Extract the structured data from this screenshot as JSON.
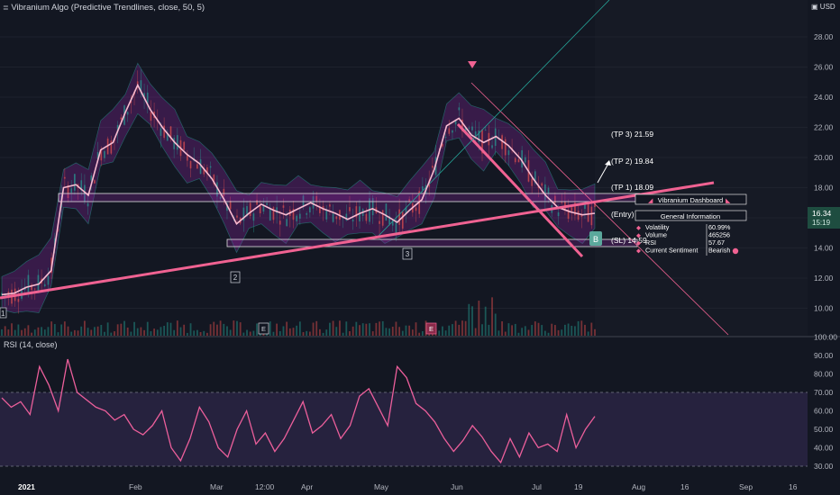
{
  "header": {
    "title": "Vibranium Algo (Predictive Trendlines, close, 50, 5)",
    "currency": "USD"
  },
  "price_axis": {
    "ticks": [
      "28.00",
      "26.00",
      "24.00",
      "22.00",
      "20.00",
      "18.00",
      "16.00",
      "14.00",
      "12.00",
      "10.00"
    ],
    "last_price": "16.34",
    "countdown": "15:19"
  },
  "rsi_axis": {
    "title": "RSI (14, close)",
    "ticks": [
      "100.00",
      "90.00",
      "80.00",
      "70.00",
      "60.00",
      "50.00",
      "40.00",
      "30.00"
    ]
  },
  "time_axis": {
    "labels": [
      "2021",
      "Feb",
      "Mar",
      "12:00",
      "Apr",
      "May",
      "Jun",
      "Jul",
      "19",
      "Aug",
      "16",
      "Sep",
      "16"
    ]
  },
  "levels": {
    "tp3": "(TP 3) 21.59",
    "tp2": "(TP 2) 19.84",
    "tp1": "(TP 1) 18.09",
    "entry": "(Entry) 16.34",
    "sl": "(SL) 14.59"
  },
  "markers": {
    "pivot_1": "1",
    "pivot_2": "2",
    "pivot_3": "3",
    "earnings_1": "E",
    "earnings_2": "E",
    "buy_signal": "B"
  },
  "dashboard": {
    "title": "Vibranium Dashboard",
    "section": "General Information",
    "rows": [
      {
        "label": "Volatility",
        "value": "60.99%"
      },
      {
        "label": "Volume",
        "value": "465256"
      },
      {
        "label": "RSI",
        "value": "57.67"
      },
      {
        "label": "Current Sentiment",
        "value": "Bearish"
      }
    ]
  },
  "colors": {
    "background": "#131722",
    "pink": "#f06292",
    "purple": "#9c27b0",
    "teal": "#26a69a",
    "rsi": "#ec5f9b",
    "last_price_bg": "#1e4d40"
  },
  "chart_data": {
    "type": "line",
    "title": "Vibranium Algo (Predictive Trendlines, close, 50, 5)",
    "x_months": [
      "2021",
      "Feb",
      "Mar",
      "Apr",
      "May",
      "Jun",
      "Jul",
      "Aug",
      "Sep"
    ],
    "ylim": [
      9,
      29
    ],
    "series": [
      {
        "values": [
          10.9,
          11.0,
          11.4,
          11.6,
          12.5,
          18.0,
          18.2,
          17.5,
          20.5,
          21.0,
          23.0,
          24.8,
          23.2,
          22.0,
          21.0,
          20.2,
          19.6,
          18.6,
          17.2,
          15.6,
          16.3,
          16.9,
          16.5,
          16.2,
          16.6,
          17.0,
          16.6,
          16.3,
          15.9,
          16.3,
          16.6,
          16.2,
          15.7,
          16.5,
          17.2,
          19.2,
          22.1,
          22.6,
          21.5,
          21.0,
          21.4,
          20.8,
          19.9,
          18.6,
          17.5,
          16.7,
          16.4,
          16.2,
          16.3
        ]
      }
    ],
    "trendlines": [
      {
        "x": [
          "2021",
          "Aug"
        ],
        "y": [
          10.9,
          18.4
        ]
      }
    ],
    "rsi": {
      "name": "RSI (14, close)",
      "ylim": [
        27,
        100
      ],
      "levels": [
        70,
        30
      ],
      "values": [
        67,
        62,
        65,
        58,
        84,
        74,
        60,
        88,
        70,
        66,
        62,
        60,
        55,
        58,
        50,
        47,
        52,
        60,
        40,
        33,
        45,
        62,
        54,
        40,
        35,
        50,
        60,
        42,
        48,
        38,
        45,
        55,
        65,
        48,
        52,
        58,
        45,
        52,
        68,
        72,
        62,
        52,
        84,
        78,
        64,
        60,
        54,
        45,
        38,
        44,
        52,
        46,
        38,
        32,
        45,
        35,
        48,
        40,
        42,
        38,
        58,
        40,
        50,
        57
      ]
    }
  }
}
